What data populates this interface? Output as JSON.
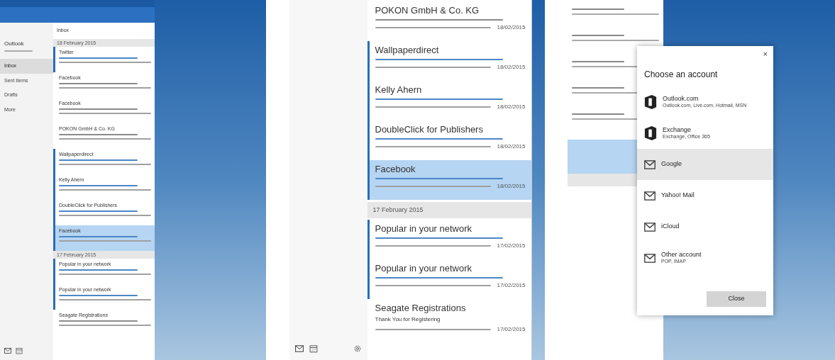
{
  "screens": [
    {
      "kind": "full_mail",
      "nav": {
        "account": "Outlook",
        "folders": [
          {
            "label": "Inbox",
            "selected": true
          },
          {
            "label": "Sent Items",
            "selected": false
          },
          {
            "label": "Drafts",
            "selected": false
          },
          {
            "label": "More",
            "selected": false
          }
        ]
      },
      "list_title": "Inbox",
      "groups": [
        {
          "header": "18 February 2015",
          "messages": [
            {
              "sender": "Twitter",
              "unread": true,
              "selected": false
            },
            {
              "sender": "Facebook",
              "unread": false,
              "selected": false
            },
            {
              "sender": "Facebook",
              "unread": false,
              "selected": false
            },
            {
              "sender": "POKON GmbH & Co. KG",
              "unread": false,
              "selected": false
            },
            {
              "sender": "Wallpaperdirect",
              "unread": true,
              "selected": false
            },
            {
              "sender": "Kelly Ahern",
              "unread": true,
              "selected": false
            },
            {
              "sender": "DoubleClick for Publishers",
              "unread": true,
              "selected": false
            },
            {
              "sender": "Facebook",
              "unread": true,
              "selected": true
            }
          ]
        },
        {
          "header": "17 February 2015",
          "messages": [
            {
              "sender": "Popular in your network",
              "unread": true,
              "selected": false
            },
            {
              "sender": "Popular in your network",
              "unread": true,
              "selected": false
            },
            {
              "sender": "Seagate Registrations",
              "unread": false,
              "selected": false
            }
          ]
        }
      ]
    },
    {
      "kind": "list_zoom",
      "groups": [
        {
          "messages": [
            {
              "sender": "POKON GmbH & Co. KG",
              "unread": false,
              "selected": false,
              "date": "18/02/2015"
            },
            {
              "sender": "Wallpaperdirect",
              "unread": true,
              "selected": false,
              "date": "18/02/2015"
            },
            {
              "sender": "Kelly Ahern",
              "unread": true,
              "selected": false,
              "date": "18/02/2015"
            },
            {
              "sender": "DoubleClick for Publishers",
              "unread": true,
              "selected": false,
              "date": "18/02/2015"
            },
            {
              "sender": "Facebook",
              "unread": true,
              "selected": true,
              "date": "18/02/2015"
            }
          ]
        },
        {
          "header": "17 February 2015",
          "messages": [
            {
              "sender": "Popular in your network",
              "unread": true,
              "selected": false,
              "date": "17/02/2015"
            },
            {
              "sender": "Popular in your network",
              "unread": true,
              "selected": false,
              "date": "17/02/2015"
            },
            {
              "sender": "Seagate Registrations",
              "subject": "Thank You for Registering",
              "unread": false,
              "selected": false,
              "date": "17/02/2015"
            }
          ]
        }
      ]
    },
    {
      "kind": "account_dialog",
      "dialog": {
        "title": "Choose an account",
        "close": "×",
        "button": "Close",
        "accounts": [
          {
            "kind": "office",
            "name": "Outlook.com",
            "detail": "Outlook.com, Live.com, Hotmail, MSN",
            "selected": false
          },
          {
            "kind": "office",
            "name": "Exchange",
            "detail": "Exchange, Office 365",
            "selected": false
          },
          {
            "kind": "mail",
            "name": "Google",
            "selected": true
          },
          {
            "kind": "mail",
            "name": "Yahoo! Mail",
            "selected": false
          },
          {
            "kind": "mail",
            "name": "iCloud",
            "selected": false
          },
          {
            "kind": "mail",
            "name": "Other account",
            "detail": "POP, IMAP",
            "selected": false
          }
        ]
      }
    }
  ]
}
